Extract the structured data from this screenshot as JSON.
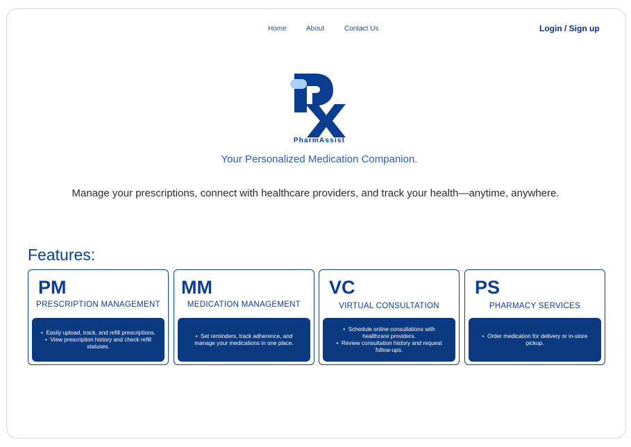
{
  "nav": {
    "home": "Home",
    "about": "About",
    "contact": "Contact Us",
    "login": "Login / Sign up"
  },
  "brand": {
    "logo_icon": "rx-logo-icon",
    "name": "PharmAssist",
    "tagline": "Your Personalized Medication Companion.",
    "subline": "Manage your prescriptions, connect with healthcare providers, and track your health—anytime, anywhere."
  },
  "colors": {
    "primary": "#0b3d91",
    "panel": "#0b3a80",
    "accent_light": "#a9d3f5"
  },
  "features": {
    "title": "Features:",
    "cards": [
      {
        "code": "PM",
        "name": "PRESCRIPTION MANAGEMENT",
        "items": [
          "Easily upload, track, and refill prescriptions.",
          "View prescription history and check refill statuses."
        ]
      },
      {
        "code": "MM",
        "name": "MEDICATION MANAGEMENT",
        "items": [
          "Set reminders, track adherence, and manage your medications in one place."
        ]
      },
      {
        "code": "VC",
        "name": "VIRTUAL CONSULTATION",
        "items": [
          "Schedule online consultations with healthcare providers.",
          "Review consultation history and request follow-ups."
        ]
      },
      {
        "code": "PS",
        "name": "PHARMACY SERVICES",
        "items": [
          "Order medication for delivery or in-store pickup."
        ]
      }
    ]
  }
}
